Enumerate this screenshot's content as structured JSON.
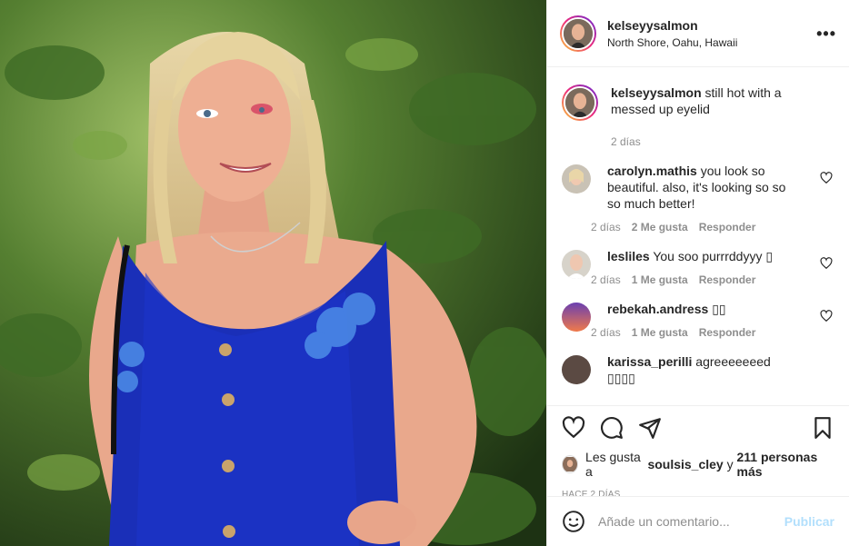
{
  "post": {
    "username": "kelseyysalmon",
    "location": "North Shore, Oahu, Hawaii",
    "more_icon": "more-options-icon"
  },
  "caption": {
    "username": "kelseyysalmon",
    "text": "still hot with a messed up eyelid",
    "time": "2 días"
  },
  "comments": [
    {
      "username": "carolyn.mathis",
      "text": "you look so beautiful. also, it's looking so so so much better!",
      "time": "2 días",
      "likes": "2 Me gusta",
      "reply": "Responder"
    },
    {
      "username": "lesliles",
      "text": "You soo purrrddyyy ▯",
      "time": "2 días",
      "likes": "1 Me gusta",
      "reply": "Responder"
    },
    {
      "username": "rebekah.andress",
      "text": "▯▯",
      "time": "2 días",
      "likes": "1 Me gusta",
      "reply": "Responder"
    },
    {
      "username": "karissa_perilli",
      "text": "agreeeeeeed ▯▯▯▯",
      "time": "",
      "likes": "",
      "reply": ""
    }
  ],
  "likes": {
    "prefix": "Les gusta a",
    "user": "soulsis_cley",
    "conj": "y",
    "others": "211 personas más"
  },
  "post_time": "HACE 2 DÍAS",
  "add_comment": {
    "placeholder": "Añade un comentario...",
    "publish": "Publicar"
  },
  "colors": {
    "accent_link": "#b2dffc",
    "text": "#262626",
    "muted": "#8e8e8e"
  }
}
